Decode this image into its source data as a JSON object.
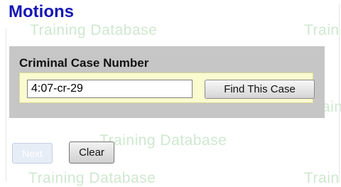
{
  "page": {
    "title": "Motions"
  },
  "watermark": {
    "text": "Training Database",
    "fragment": "Train",
    "fragment_mid": "ain",
    "color": "#cfe8cf"
  },
  "search": {
    "label": "Criminal Case Number",
    "value": "4:07-cr-29",
    "find_label": "Find This Case"
  },
  "actions": {
    "next_label": "Next",
    "next_enabled": false,
    "clear_label": "Clear"
  },
  "colors": {
    "title": "#1616b3",
    "panel_background": "#c6c6c6",
    "input_area_background": "#fbfbd0"
  }
}
